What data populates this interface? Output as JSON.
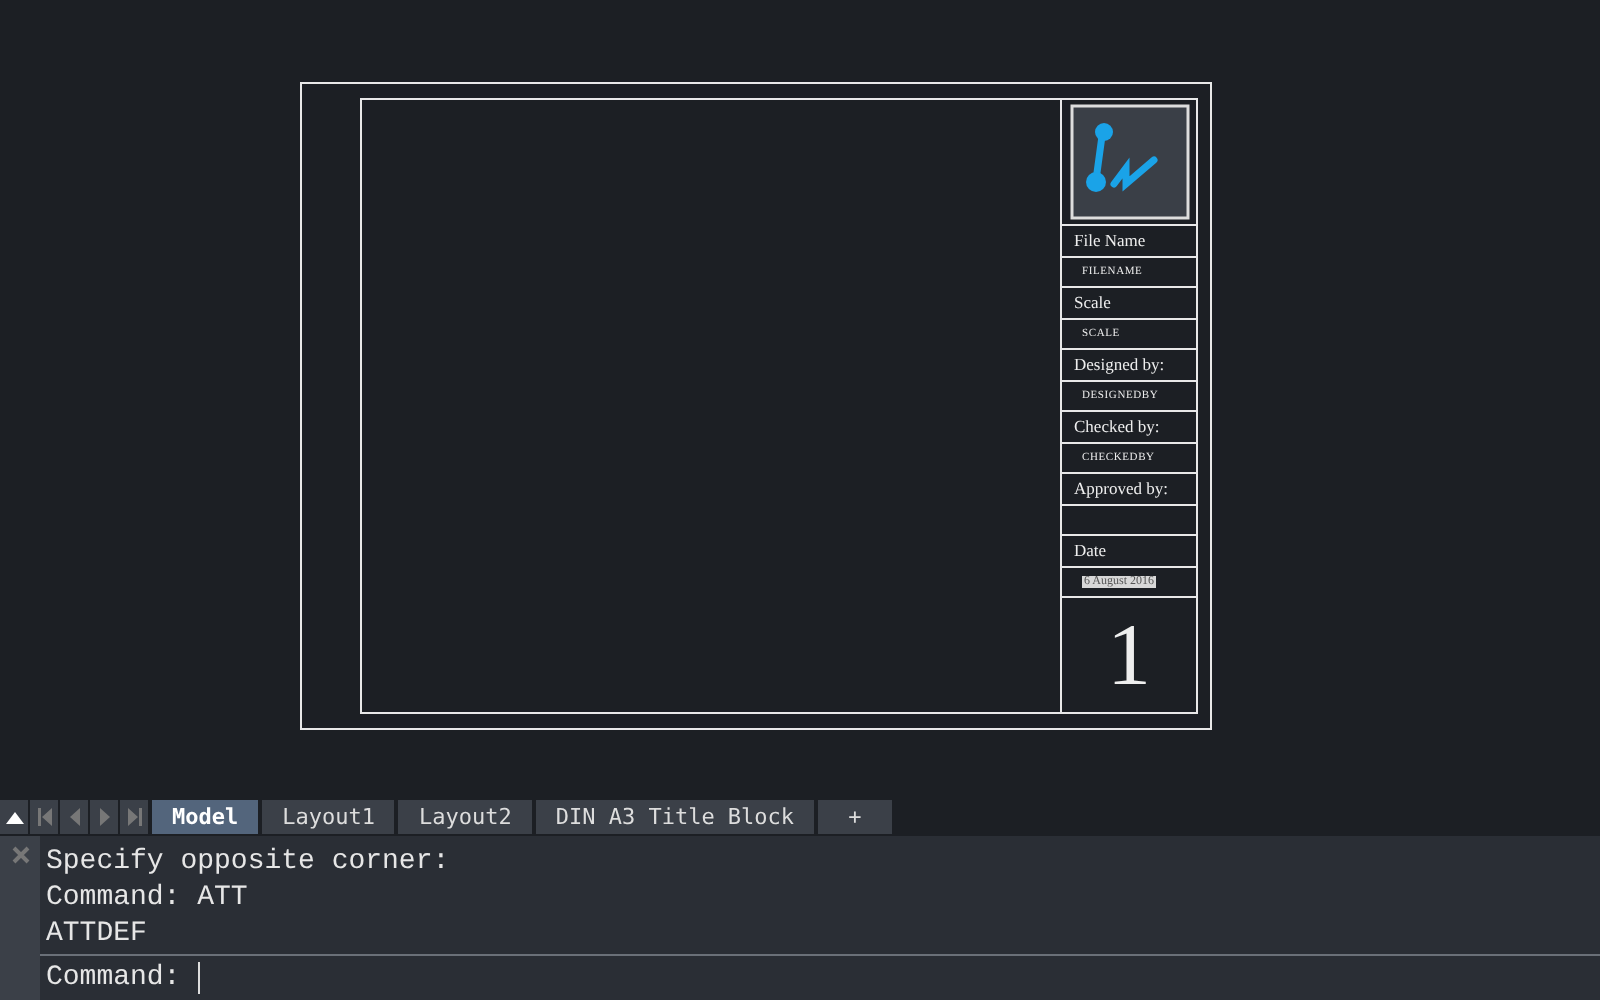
{
  "title_block": {
    "rows": [
      {
        "kind": "label",
        "text": "File Name"
      },
      {
        "kind": "tag",
        "text": "FILENAME"
      },
      {
        "kind": "label",
        "text": "Scale"
      },
      {
        "kind": "tag",
        "text": "SCALE"
      },
      {
        "kind": "label",
        "text": "Designed by:"
      },
      {
        "kind": "tag",
        "text": "DESIGNEDBY"
      },
      {
        "kind": "label",
        "text": "Checked by:"
      },
      {
        "kind": "tag",
        "text": "CHECKEDBY"
      },
      {
        "kind": "label",
        "text": "Approved by:"
      },
      {
        "kind": "empty"
      },
      {
        "kind": "label",
        "text": "Date"
      },
      {
        "kind": "highlight",
        "text": "6 August 2016"
      }
    ],
    "sheet_number": "1"
  },
  "layout_tabs": [
    {
      "label": "Model",
      "selected": true
    },
    {
      "label": "Layout1",
      "selected": false
    },
    {
      "label": "Layout2",
      "selected": false
    },
    {
      "label": "DIN A3 Title Block",
      "selected": false
    }
  ],
  "add_tab": "+",
  "command_history": [
    "Specify opposite corner:",
    "Command: ATT",
    "ATTDEF"
  ],
  "command_prompt": "Command:"
}
